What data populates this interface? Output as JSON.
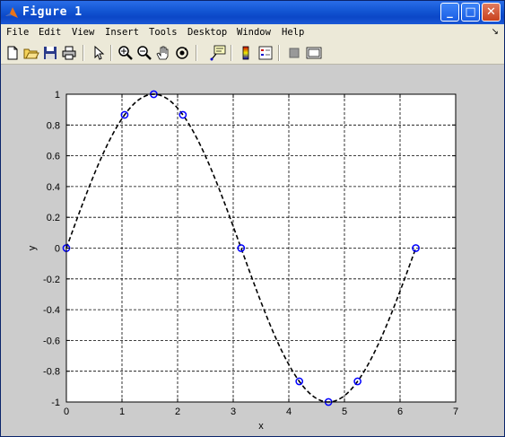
{
  "window": {
    "title": "Figure 1",
    "minimize_glyph": "_",
    "maximize_glyph": "□",
    "close_glyph": "✕",
    "icon": "matlab-logo-icon"
  },
  "menu": [
    {
      "label": "File"
    },
    {
      "label": "Edit"
    },
    {
      "label": "View"
    },
    {
      "label": "Insert"
    },
    {
      "label": "Tools"
    },
    {
      "label": "Desktop"
    },
    {
      "label": "Window"
    },
    {
      "label": "Help"
    }
  ],
  "menu_arrow": "↘",
  "toolbar": [
    "new-figure-icon",
    "open-file-icon",
    "save-icon",
    "print-icon",
    "edit-plot-arrow-icon",
    "zoom-in-icon",
    "zoom-out-icon",
    "pan-hand-icon",
    "rotate-3d-icon",
    "data-cursor-icon",
    "insert-colorbar-icon",
    "insert-legend-icon",
    "hide-plot-tools-icon",
    "show-plot-tools-icon"
  ],
  "chart_data": {
    "type": "line",
    "xlabel": "x",
    "ylabel": "y",
    "xlim": [
      0,
      7
    ],
    "ylim": [
      -1,
      1
    ],
    "xticks": [
      "0",
      "1",
      "2",
      "3",
      "4",
      "5",
      "6",
      "7"
    ],
    "yticks": [
      "1",
      "0.8",
      "0.6",
      "0.4",
      "0.2",
      "0",
      "-0.2",
      "-0.4",
      "-0.6",
      "-0.8",
      "-1"
    ],
    "grid": true,
    "series": [
      {
        "style": "dashed black curve, y = sin(x) from 0 to 2π",
        "color": "#000000",
        "x_start": 0,
        "x_end": 6.2832,
        "function": "sin"
      },
      {
        "style": "blue circle markers",
        "color": "#0000ff",
        "points": [
          [
            0,
            0
          ],
          [
            1.0472,
            0.866
          ],
          [
            1.5708,
            1.0
          ],
          [
            2.0944,
            0.866
          ],
          [
            3.1416,
            0.0
          ],
          [
            4.1888,
            -0.866
          ],
          [
            4.7124,
            -1.0
          ],
          [
            5.236,
            -0.866
          ],
          [
            6.2832,
            0.0
          ]
        ]
      }
    ]
  }
}
